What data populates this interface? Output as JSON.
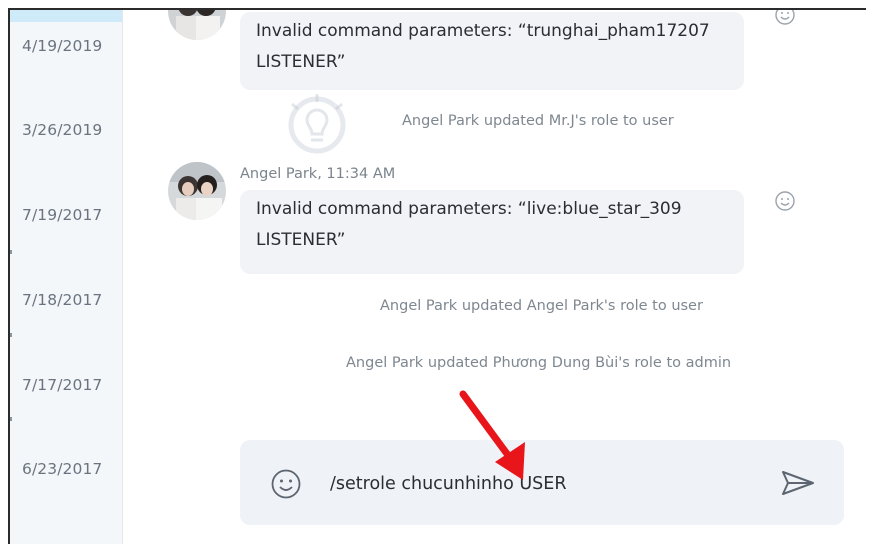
{
  "dates": [
    "4/19/2019",
    "3/26/2019",
    "7/19/2017",
    "7/18/2017",
    "7/17/2017",
    "6/23/2017"
  ],
  "messages": [
    {
      "text_line1": "Invalid command parameters: “trunghai_pham17207",
      "text_line2": "LISTENER”"
    },
    {
      "sender": "Angel Park, 11:34 AM",
      "text_line1": "Invalid command parameters: “live:blue_star_309",
      "text_line2": "LISTENER”"
    }
  ],
  "system_messages": [
    "Angel Park updated Mr.J's role to user",
    "Angel Park updated Angel Park's role to user",
    "Angel Park updated Phương Dung Bùi's role to admin"
  ],
  "compose": {
    "value": "/setrole chucunhinho USER"
  },
  "icons": {
    "emoji": "smiley-icon",
    "send": "send-icon",
    "reaction": "smiley-icon"
  },
  "colors": {
    "arrow": "#e8161b",
    "sidebar_bg": "#f4f7fa",
    "bubble_bg": "#f1f3f7"
  }
}
